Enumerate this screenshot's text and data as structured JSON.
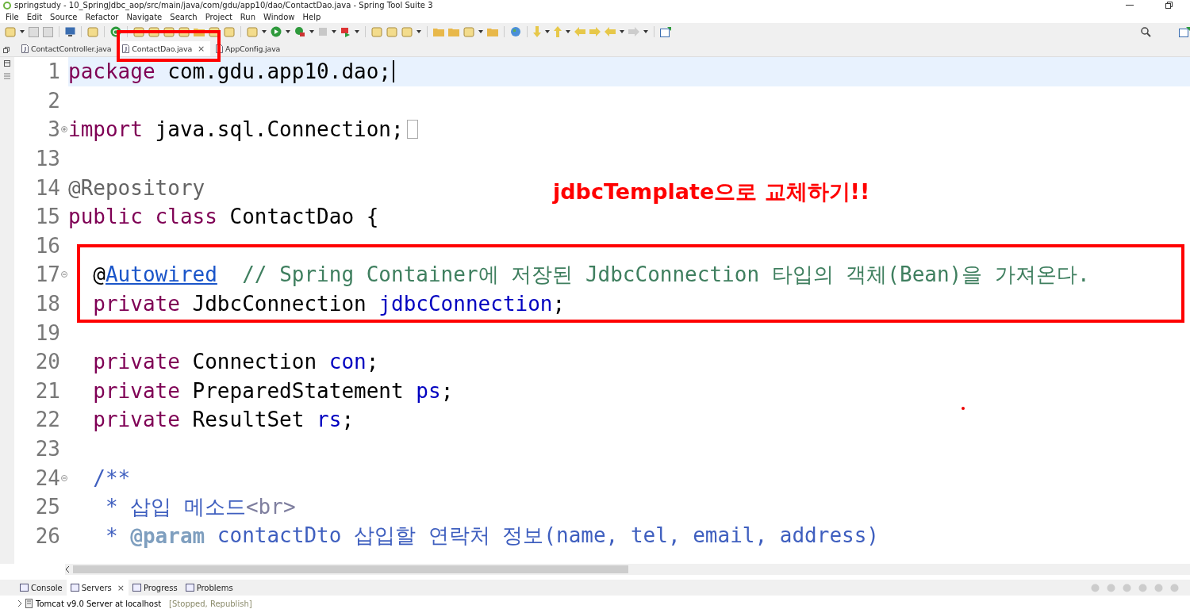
{
  "window": {
    "title": "springstudy - 10_SpringJdbc_aop/src/main/java/com/gdu/app10/dao/ContactDao.java - Spring Tool Suite 3"
  },
  "menu": [
    "File",
    "Edit",
    "Source",
    "Refactor",
    "Navigate",
    "Search",
    "Project",
    "Run",
    "Window",
    "Help"
  ],
  "editor_tabs": [
    {
      "label": "ContactController.java",
      "selected": false
    },
    {
      "label": "ContactDao.java",
      "selected": true,
      "close": "×"
    },
    {
      "label": "AppConfig.java",
      "selected": false
    }
  ],
  "code_lines": [
    {
      "number": "1",
      "current": true,
      "tokens": [
        {
          "kind": "keyword",
          "text": "package"
        },
        {
          "kind": "plain",
          "text": " com.gdu.app10.dao;"
        }
      ]
    },
    {
      "number": "2",
      "current": false
    },
    {
      "number": "3",
      "current": false,
      "collapsed": true,
      "tokens": [
        {
          "kind": "keyword",
          "text": "import"
        },
        {
          "kind": "plain",
          "text": " java.sql.Connection;"
        }
      ]
    },
    {
      "number": "13",
      "current": false
    },
    {
      "number": "14",
      "current": false,
      "tokens": [
        {
          "kind": "annotation",
          "text": "@Repository"
        }
      ]
    },
    {
      "number": "15",
      "current": false,
      "tokens": [
        {
          "kind": "keyword",
          "text": "public class"
        },
        {
          "kind": "plain",
          "text": " ContactDao {"
        }
      ]
    },
    {
      "number": "16",
      "current": false
    },
    {
      "number": "17",
      "current": false,
      "collapsed": false,
      "tokens": [
        {
          "kind": "plain",
          "text": "  @"
        },
        {
          "kind": "link",
          "text": "Autowired"
        },
        {
          "kind": "comment",
          "text": "  // Spring Container에 저장된 JdbcConnection 타입의 객체(Bean)을 가져온다."
        }
      ]
    },
    {
      "number": "18",
      "current": false,
      "tokens": [
        {
          "kind": "keyword",
          "text": "  private"
        },
        {
          "kind": "plain",
          "text": " JdbcConnection "
        },
        {
          "kind": "field",
          "text": "jdbcConnection"
        },
        {
          "kind": "plain",
          "text": ";"
        }
      ]
    },
    {
      "number": "19",
      "current": false
    },
    {
      "number": "20",
      "current": false,
      "tokens": [
        {
          "kind": "keyword",
          "text": "  private"
        },
        {
          "kind": "plain",
          "text": " Connection "
        },
        {
          "kind": "field",
          "text": "con"
        },
        {
          "kind": "plain",
          "text": ";"
        }
      ]
    },
    {
      "number": "21",
      "current": false,
      "tokens": [
        {
          "kind": "keyword",
          "text": "  private"
        },
        {
          "kind": "plain",
          "text": " PreparedStatement "
        },
        {
          "kind": "field",
          "text": "ps"
        },
        {
          "kind": "plain",
          "text": ";"
        }
      ]
    },
    {
      "number": "22",
      "current": false,
      "tokens": [
        {
          "kind": "keyword",
          "text": "  private"
        },
        {
          "kind": "plain",
          "text": " ResultSet "
        },
        {
          "kind": "field",
          "text": "rs"
        },
        {
          "kind": "plain",
          "text": ";"
        }
      ]
    },
    {
      "number": "23",
      "current": false
    },
    {
      "number": "24",
      "current": false,
      "collapsed": false,
      "tokens": [
        {
          "kind": "javadoc",
          "text": "  /**"
        }
      ]
    },
    {
      "number": "25",
      "current": false,
      "tokens": [
        {
          "kind": "javadoc",
          "text": "   * 삽입 메소드"
        },
        {
          "kind": "html",
          "text": "<br>"
        }
      ]
    },
    {
      "number": "26",
      "current": false,
      "tokens": [
        {
          "kind": "javadoc",
          "text": "   * "
        },
        {
          "kind": "doctag",
          "text": "@param"
        },
        {
          "kind": "javadoc",
          "text": " contactDto 삽입할 연락처 정보(name, tel, email, address)"
        }
      ]
    }
  ],
  "annotation_note": "jdbcTemplate으로 교체하기!!",
  "bottom_tabs": [
    {
      "label": "Console",
      "selected": false
    },
    {
      "label": "Servers",
      "selected": true,
      "close": "×"
    },
    {
      "label": "Progress",
      "selected": false
    },
    {
      "label": "Problems",
      "selected": false
    }
  ],
  "servers": [
    {
      "name": "Tomcat v9.0 Server at localhost",
      "status": "[Stopped, Republish]",
      "expanded": false
    }
  ]
}
